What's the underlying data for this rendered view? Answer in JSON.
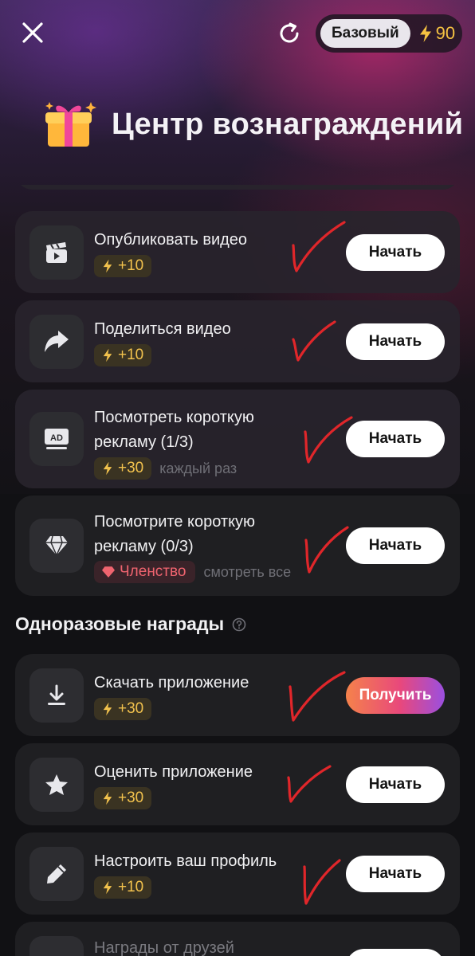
{
  "header": {
    "plan_label": "Базовый",
    "energy_balance": "90",
    "title": "Центр вознаграждений"
  },
  "tasks": [
    {
      "title": "Опубликовать видео",
      "reward": "+10",
      "button": "Начать",
      "icon": "video-clip-icon"
    },
    {
      "title": "Поделиться видео",
      "reward": "+10",
      "button": "Начать",
      "icon": "share-arrow-icon"
    },
    {
      "title_line1": "Посмотреть короткую",
      "title_line2": "рекламу (1/3)",
      "reward": "+30",
      "note": "каждый раз",
      "button": "Начать",
      "icon": "ad-icon"
    },
    {
      "title_line1": "Посмотрите короткую",
      "title_line2": "рекламу (0/3)",
      "member_label": "Членство",
      "note": "смотреть все",
      "button": "Начать",
      "icon": "diamond-icon"
    }
  ],
  "one_time": {
    "section_title": "Одноразовые награды",
    "items": [
      {
        "title": "Скачать приложение",
        "reward": "+30",
        "button": "Получить",
        "icon": "download-icon"
      },
      {
        "title": "Оценить приложение",
        "reward": "+30",
        "button": "Начать",
        "icon": "star-icon"
      },
      {
        "title": "Настроить ваш профиль",
        "reward": "+10",
        "button": "Начать",
        "icon": "pencil-icon"
      },
      {
        "title": "Награды от друзей",
        "icon": "friends-icon"
      }
    ]
  },
  "colors": {
    "accent_gold": "#f2c24d",
    "member_red": "#f0646f",
    "claim_gradient_start": "#f5824b",
    "claim_gradient_end": "#9a4fe0",
    "annotation_red": "#e0262a"
  }
}
